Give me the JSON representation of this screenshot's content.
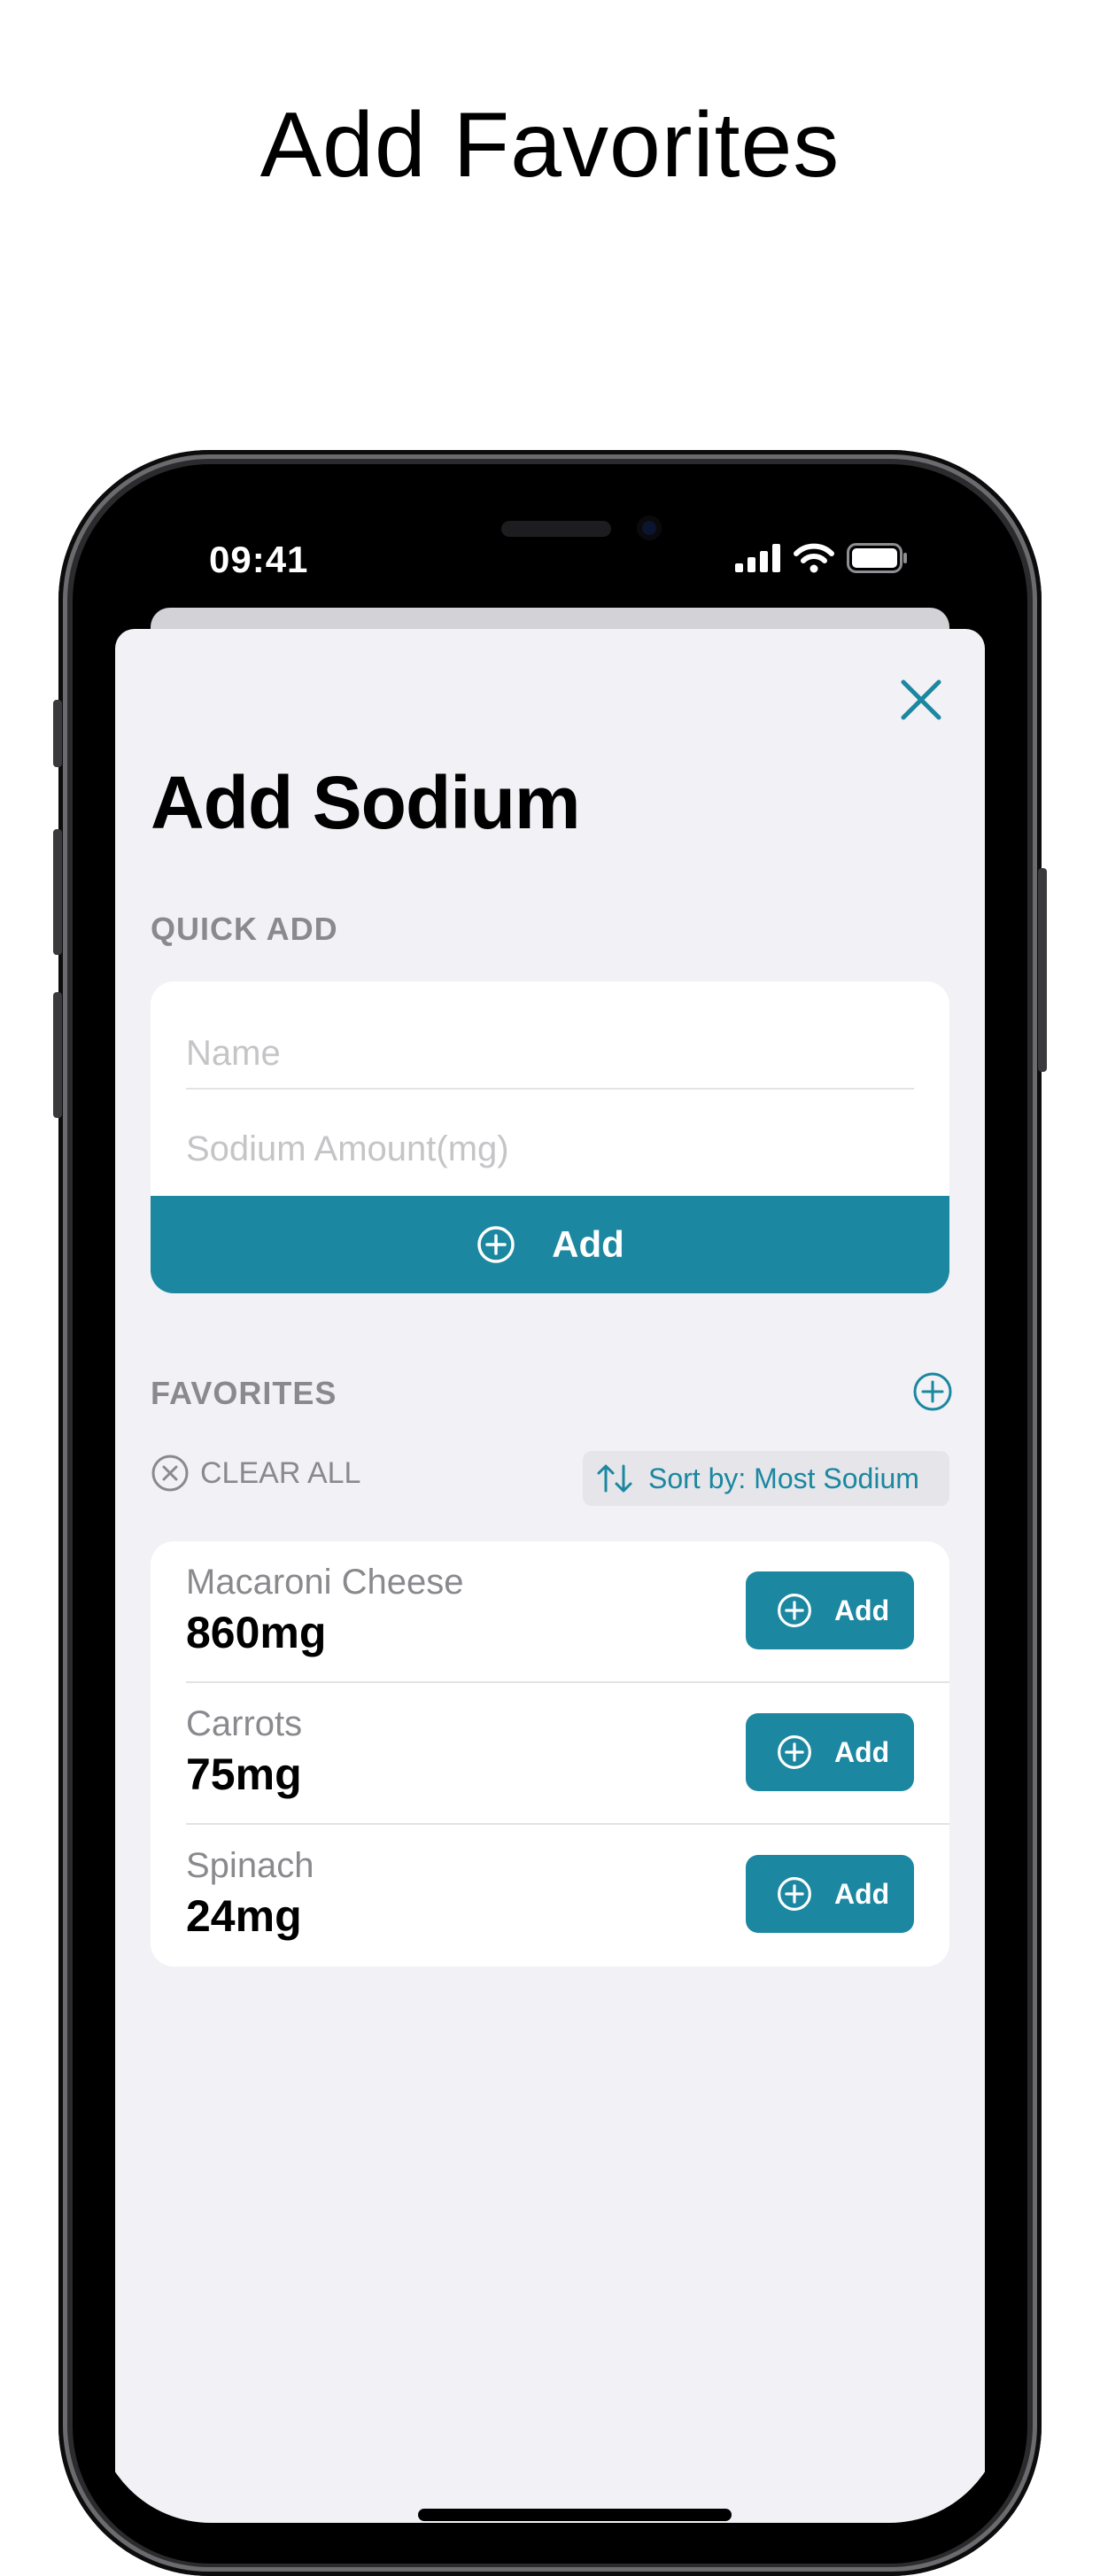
{
  "headline": "Add Favorites",
  "status_bar": {
    "time": "09:41"
  },
  "sheet": {
    "title": "Add Sodium",
    "quick_add": {
      "section_label": "QUICK ADD",
      "name_placeholder": "Name",
      "amount_placeholder": "Sodium Amount(mg)",
      "add_label": "Add"
    },
    "favorites": {
      "section_label": "FAVORITES",
      "clear_all_label": "CLEAR ALL",
      "sort_label": "Sort by: Most Sodium",
      "items": [
        {
          "name": "Macaroni Cheese",
          "amount": "860mg",
          "add_label": "Add"
        },
        {
          "name": "Carrots",
          "amount": "75mg",
          "add_label": "Add"
        },
        {
          "name": "Spinach",
          "amount": "24mg",
          "add_label": "Add"
        }
      ]
    }
  },
  "colors": {
    "accent": "#1b87a0",
    "sheet_background": "#f1f1f6",
    "secondary_text": "#8a8a8e"
  },
  "icons": {
    "close": "close-icon",
    "add": "plus-circle-icon",
    "clear": "x-circle-icon",
    "sort": "sort-arrows-icon"
  }
}
